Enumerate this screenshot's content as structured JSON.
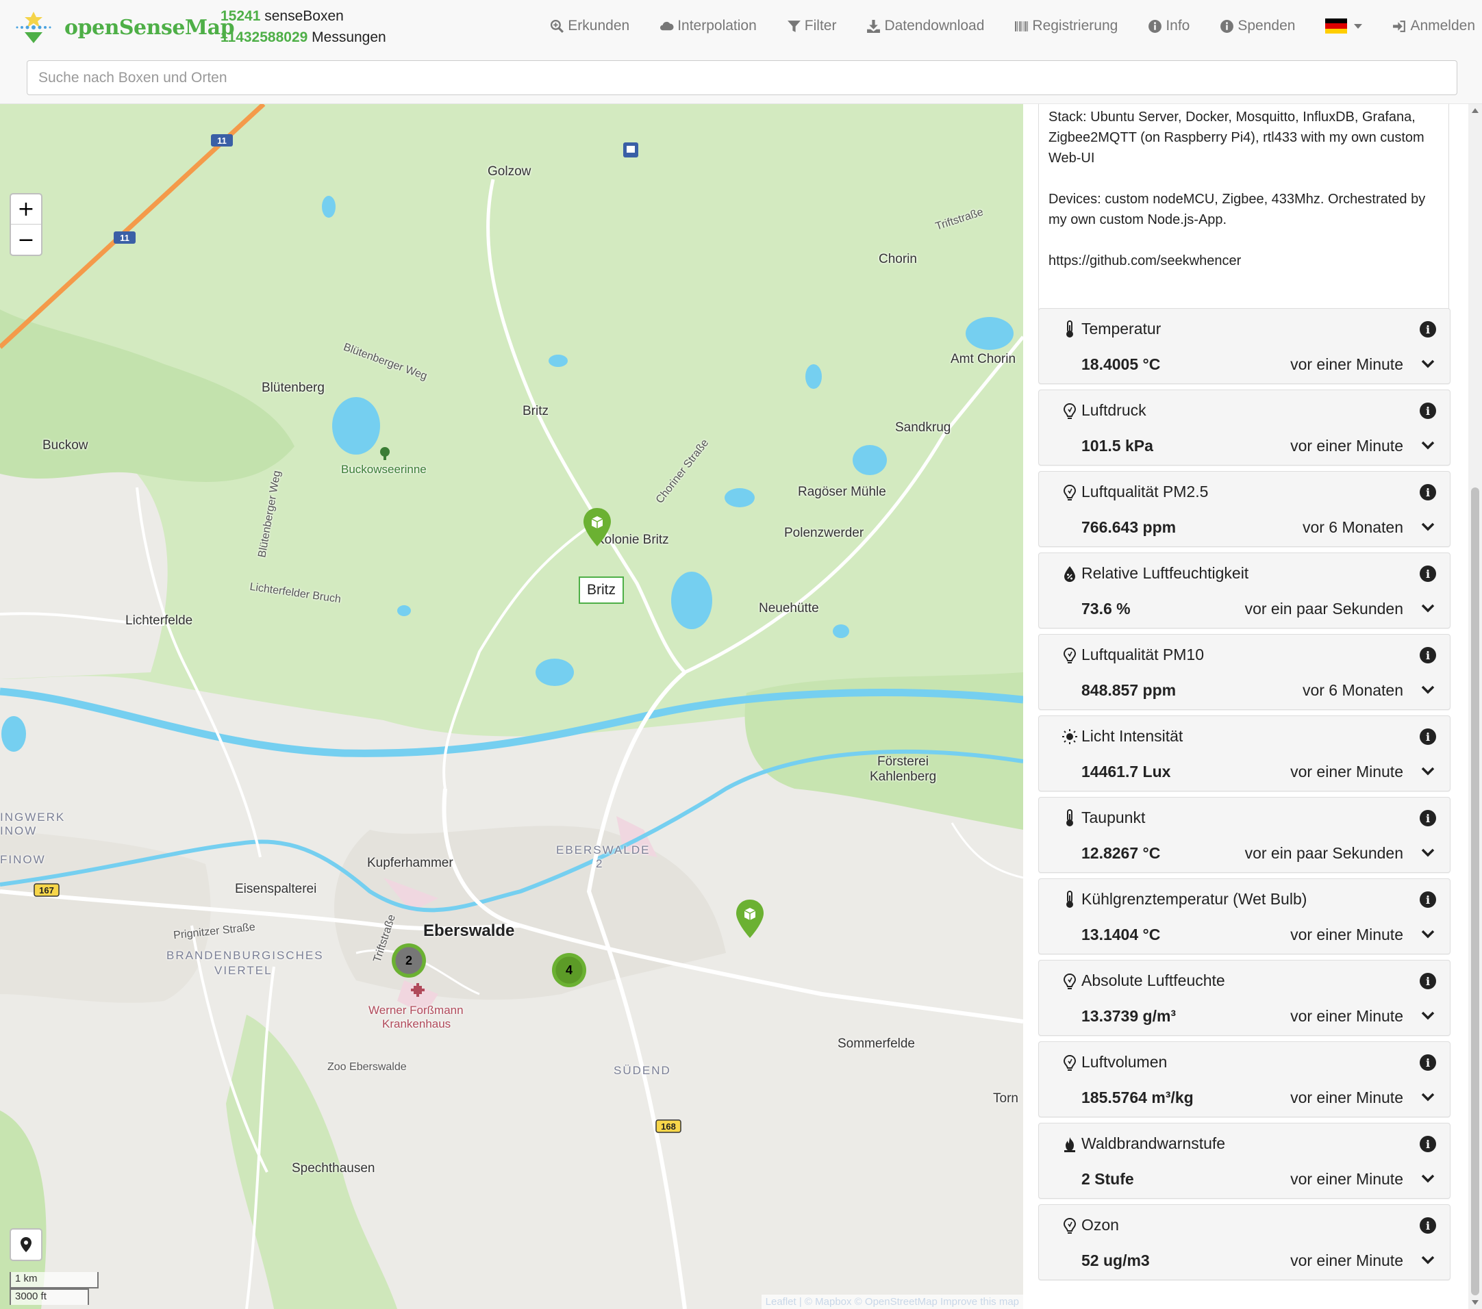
{
  "brand": {
    "name": "openSenseMap"
  },
  "stats": {
    "boxes_count": "15241",
    "boxes_label": "senseBoxen",
    "measurements_count": "11432588029",
    "measurements_label": "Messungen"
  },
  "nav": {
    "explore": "Erkunden",
    "interpolation": "Interpolation",
    "filter": "Filter",
    "download": "Datendownload",
    "register": "Registrierung",
    "info": "Info",
    "donate": "Spenden",
    "language_icon": "flag-de",
    "login": "Anmelden"
  },
  "search": {
    "placeholder": "Suche nach Boxen und Orten"
  },
  "map": {
    "zoom_in": "+",
    "zoom_out": "−",
    "scale_metric": "1 km",
    "scale_imperial": "3000 ft",
    "tooltip": "Britz",
    "attribution": "Leaflet | © Mapbox © OpenStreetMap Improve this map",
    "road_shields": {
      "a11_top": "11",
      "a11_bottom": "11",
      "b167": "167",
      "b168": "168"
    },
    "clusters": {
      "a": "2",
      "b": "4"
    },
    "labels": {
      "golzow": "Golzow",
      "triftstrasse_ne": "Triftstraße",
      "chorin": "Chorin",
      "amt_chorin": "Amt Chorin",
      "bluetenberger_weg": "Blütenberger Weg",
      "bluetenberg": "Blütenberg",
      "britz": "Britz",
      "sandkrug": "Sandkrug",
      "buckow": "Buckow",
      "buckowseerinne": "Buckowseerinne",
      "choriner_strasse": "Choriner Straße",
      "ragoeser_muehle": "Ragöser Mühle",
      "kolonie_britz": "Kolonie Britz",
      "polenzwerder": "Polenzwerder",
      "bluetenberger_weg_v": "Blütenberger Weg",
      "lichterfelder_bruch": "Lichterfelder Bruch",
      "lichterfelde": "Lichterfelde",
      "neuehuette": "Neuehütte",
      "foersterei": "Försterei",
      "kahlenberg": "Kahlenberg",
      "walzwerk": "INGWERK",
      "finow_top": "INOW",
      "finow": "FINOW",
      "kupferhammer": "Kupferhammer",
      "eberswalde2": "EBERSWALDE",
      "eberswalde2_num": "2",
      "eisenspalterei": "Eisenspalterei",
      "eberswalde": "Eberswalde",
      "prignitzer": "Prignitzer Straße",
      "triftstrasse_s": "Triftstraße",
      "brandenburgisches": "BRANDENBURGISCHES",
      "viertel": "VIERTEL",
      "krankenhaus1": "Werner Forßmann",
      "krankenhaus2": "Krankenhaus",
      "zoo": "Zoo Eberswalde",
      "sommerfelde": "Sommerfelde",
      "suedend": "SÜDEND",
      "torn": "Torn",
      "spechthausen": "Spechthausen"
    }
  },
  "description": {
    "stack": "Stack: Ubuntu Server, Docker, Mosquitto, InfluxDB, Grafana, Zigbee2MQTT (on Raspberry Pi4), rtl433 with my own custom Web-UI",
    "devices": "Devices: custom nodeMCU, Zigbee, 433Mhz. Orchestrated by my own custom Node.js-App.",
    "link": "https://github.com/seekwhencer"
  },
  "sensors": [
    {
      "icon": "thermometer-icon",
      "title": "Temperatur",
      "value": "18.4005 °C",
      "time": "vor einer Minute"
    },
    {
      "icon": "osem-generic-icon",
      "title": "Luftdruck",
      "value": "101.5 kPa",
      "time": "vor einer Minute"
    },
    {
      "icon": "osem-generic-icon",
      "title": "Luftqualität PM2.5",
      "value": "766.643 ppm",
      "time": "vor 6 Monaten"
    },
    {
      "icon": "humidity-icon",
      "title": "Relative Luftfeuchtigkeit",
      "value": "73.6 %",
      "time": "vor ein paar Sekunden"
    },
    {
      "icon": "osem-generic-icon",
      "title": "Luftqualität PM10",
      "value": "848.857 ppm",
      "time": "vor 6 Monaten"
    },
    {
      "icon": "sun-icon",
      "title": "Licht Intensität",
      "value": "14461.7 Lux",
      "time": "vor einer Minute"
    },
    {
      "icon": "thermometer-icon",
      "title": "Taupunkt",
      "value": "12.8267 °C",
      "time": "vor ein paar Sekunden"
    },
    {
      "icon": "thermometer-icon",
      "title": "Kühlgrenztemperatur (Wet Bulb)",
      "value": "13.1404 °C",
      "time": "vor einer Minute"
    },
    {
      "icon": "osem-generic-icon",
      "title": "Absolute Luftfeuchte",
      "value": "13.3739 g/m³",
      "time": "vor einer Minute"
    },
    {
      "icon": "osem-generic-icon",
      "title": "Luftvolumen",
      "value": "185.5764 m³/kg",
      "time": "vor einer Minute"
    },
    {
      "icon": "fire-icon",
      "title": "Waldbrandwarnstufe",
      "value": "2 Stufe",
      "time": "vor einer Minute"
    },
    {
      "icon": "osem-generic-icon",
      "title": "Ozon",
      "value": "52 ug/m3",
      "time": "vor einer Minute"
    }
  ],
  "colors": {
    "brand_green": "#4EAF47",
    "water": "#75cff0",
    "forest": "#cde6b5",
    "motorway": "#f49a4a"
  }
}
